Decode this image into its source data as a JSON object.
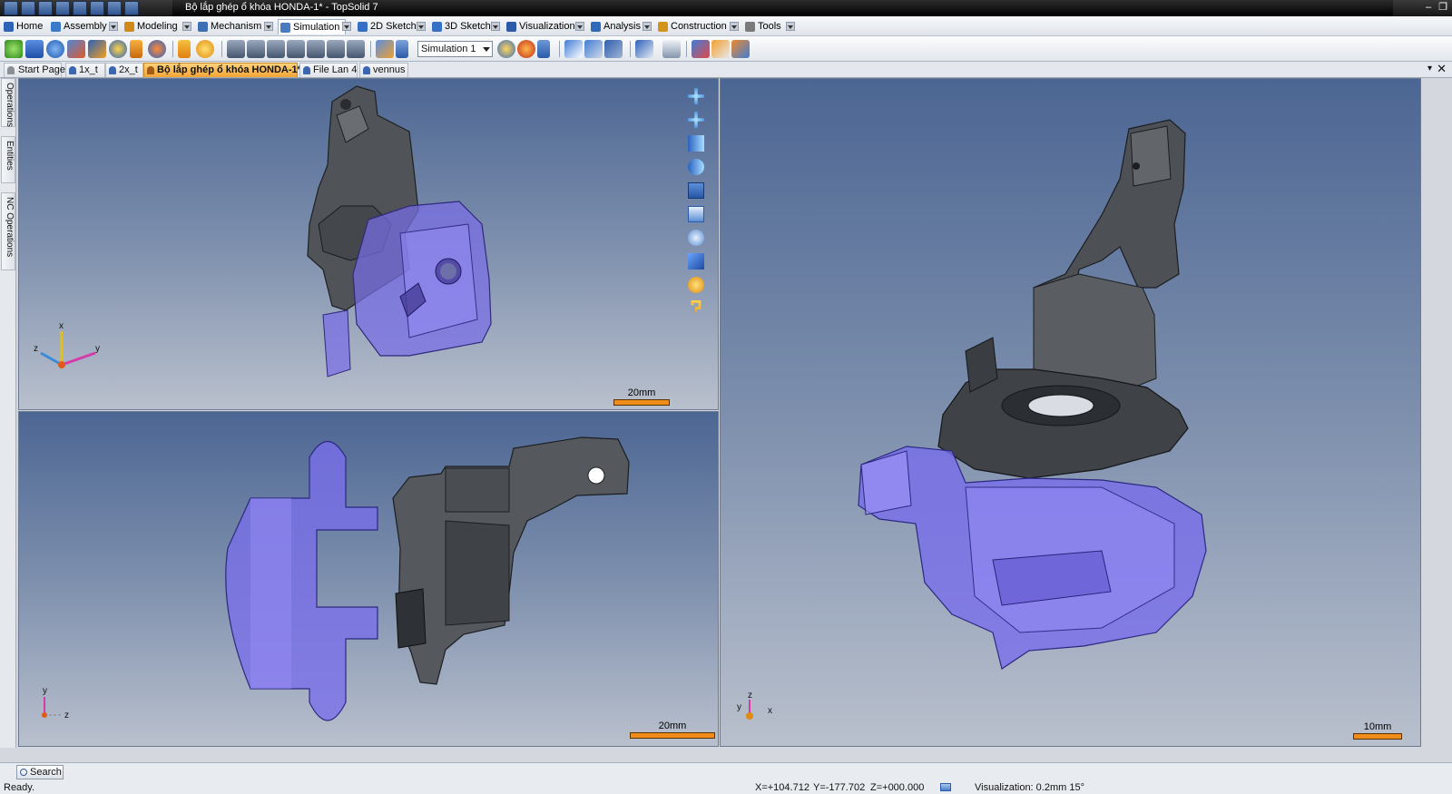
{
  "window": {
    "title": "Bộ lắp ghép ổ khóa HONDA-1* - TopSolid 7",
    "controls": [
      "–",
      "❐"
    ]
  },
  "menu": {
    "tabs": [
      {
        "label": "Home",
        "color": "#2e64b8"
      },
      {
        "label": "Assembly",
        "color": "#3a7ac8"
      },
      {
        "label": "Modeling",
        "color": "#d08a1a"
      },
      {
        "label": "Mechanism",
        "color": "#3c6fb4"
      },
      {
        "label": "Simulation",
        "color": "#4a7bc0"
      },
      {
        "label": "2D Sketch",
        "color": "#3570c4"
      },
      {
        "label": "3D Sketch",
        "color": "#3570c4"
      },
      {
        "label": "Visualization",
        "color": "#2c5aa8"
      },
      {
        "label": "Analysis",
        "color": "#2e6ab8"
      },
      {
        "label": "Construction",
        "color": "#d4941c"
      },
      {
        "label": "Tools",
        "color": "#7a7a7a"
      }
    ],
    "active": "Simulation"
  },
  "toolbar": {
    "simulation_select": "Simulation 1"
  },
  "doc_tabs": {
    "items": [
      {
        "label": "Start Page",
        "active": false
      },
      {
        "label": "1x_t",
        "active": false
      },
      {
        "label": "2x_t",
        "active": false
      },
      {
        "label": "Bộ lắp ghép ổ khóa HONDA-1*",
        "active": true
      },
      {
        "label": "File Lan 4",
        "active": false
      },
      {
        "label": "vennus",
        "active": false
      }
    ],
    "pin": "▾",
    "close": "✕"
  },
  "side_panel": {
    "tabs": [
      "Operations",
      "Entities",
      "NC Operations"
    ]
  },
  "viewports": {
    "top_left": {
      "scale": "20mm",
      "triad": {
        "x": "x",
        "y": "y",
        "z": "z"
      }
    },
    "bottom_left": {
      "scale": "20mm",
      "triad": {
        "y": "y",
        "z": "z"
      }
    },
    "right": {
      "scale": "10mm",
      "triad": {
        "z": "z",
        "y": "y",
        "x": "x"
      }
    }
  },
  "status": {
    "search_label": "Search",
    "ready": "Ready.",
    "x": "X=+104.712",
    "y": "Y=-177.702",
    "z": "Z=+000.000",
    "visualization": "Visualization: 0.2mm 15°"
  }
}
